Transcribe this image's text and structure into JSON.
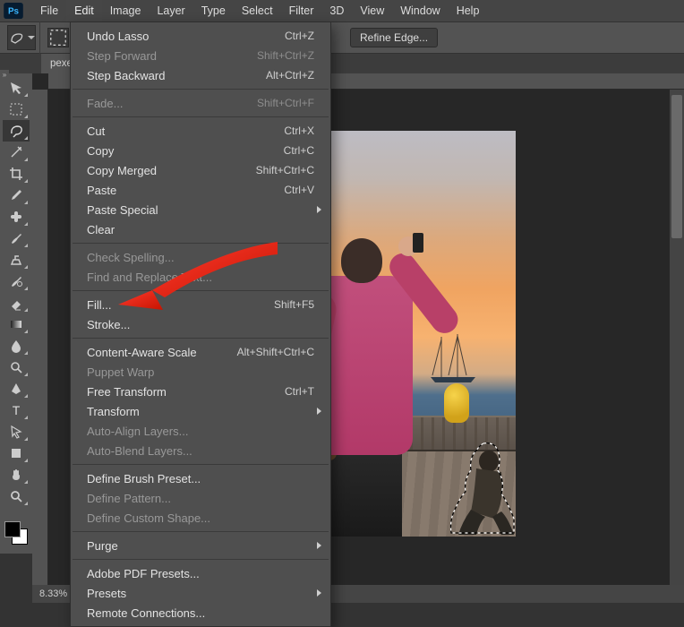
{
  "menubar": {
    "items": [
      "File",
      "Edit",
      "Image",
      "Layer",
      "Type",
      "Select",
      "Filter",
      "3D",
      "View",
      "Window",
      "Help"
    ],
    "open_index": 1
  },
  "optionsbar": {
    "refine_edge": "Refine Edge..."
  },
  "tabs": {
    "doc": "pexe"
  },
  "tools": [
    {
      "name": "move-tool"
    },
    {
      "name": "marquee-tool"
    },
    {
      "name": "lasso-tool",
      "selected": true
    },
    {
      "name": "magic-wand-tool"
    },
    {
      "name": "crop-tool"
    },
    {
      "name": "eyedropper-tool"
    },
    {
      "name": "healing-brush-tool"
    },
    {
      "name": "brush-tool"
    },
    {
      "name": "clone-stamp-tool"
    },
    {
      "name": "history-brush-tool"
    },
    {
      "name": "eraser-tool"
    },
    {
      "name": "gradient-tool"
    },
    {
      "name": "blur-tool"
    },
    {
      "name": "dodge-tool"
    },
    {
      "name": "pen-tool"
    },
    {
      "name": "type-tool"
    },
    {
      "name": "path-selection-tool"
    },
    {
      "name": "shape-tool"
    },
    {
      "name": "hand-tool"
    },
    {
      "name": "zoom-tool"
    }
  ],
  "edit_menu": [
    {
      "label": "Undo Lasso",
      "accel": "Ctrl+Z"
    },
    {
      "label": "Step Forward",
      "accel": "Shift+Ctrl+Z",
      "disabled": true
    },
    {
      "label": "Step Backward",
      "accel": "Alt+Ctrl+Z"
    },
    {
      "sep": true
    },
    {
      "label": "Fade...",
      "accel": "Shift+Ctrl+F",
      "disabled": true
    },
    {
      "sep": true
    },
    {
      "label": "Cut",
      "accel": "Ctrl+X"
    },
    {
      "label": "Copy",
      "accel": "Ctrl+C"
    },
    {
      "label": "Copy Merged",
      "accel": "Shift+Ctrl+C"
    },
    {
      "label": "Paste",
      "accel": "Ctrl+V"
    },
    {
      "label": "Paste Special",
      "sub": true
    },
    {
      "label": "Clear"
    },
    {
      "sep": true
    },
    {
      "label": "Check Spelling...",
      "disabled": true
    },
    {
      "label": "Find and Replace Text...",
      "disabled": true
    },
    {
      "sep": true
    },
    {
      "label": "Fill...",
      "accel": "Shift+F5"
    },
    {
      "label": "Stroke..."
    },
    {
      "sep": true
    },
    {
      "label": "Content-Aware Scale",
      "accel": "Alt+Shift+Ctrl+C"
    },
    {
      "label": "Puppet Warp",
      "disabled": true
    },
    {
      "label": "Free Transform",
      "accel": "Ctrl+T"
    },
    {
      "label": "Transform",
      "sub": true
    },
    {
      "label": "Auto-Align Layers...",
      "disabled": true
    },
    {
      "label": "Auto-Blend Layers...",
      "disabled": true
    },
    {
      "sep": true
    },
    {
      "label": "Define Brush Preset..."
    },
    {
      "label": "Define Pattern...",
      "disabled": true
    },
    {
      "label": "Define Custom Shape...",
      "disabled": true
    },
    {
      "sep": true
    },
    {
      "label": "Purge",
      "sub": true
    },
    {
      "sep": true
    },
    {
      "label": "Adobe PDF Presets..."
    },
    {
      "label": "Presets",
      "sub": true
    },
    {
      "label": "Remote Connections..."
    }
  ],
  "status": {
    "zoom": "8.33%"
  }
}
